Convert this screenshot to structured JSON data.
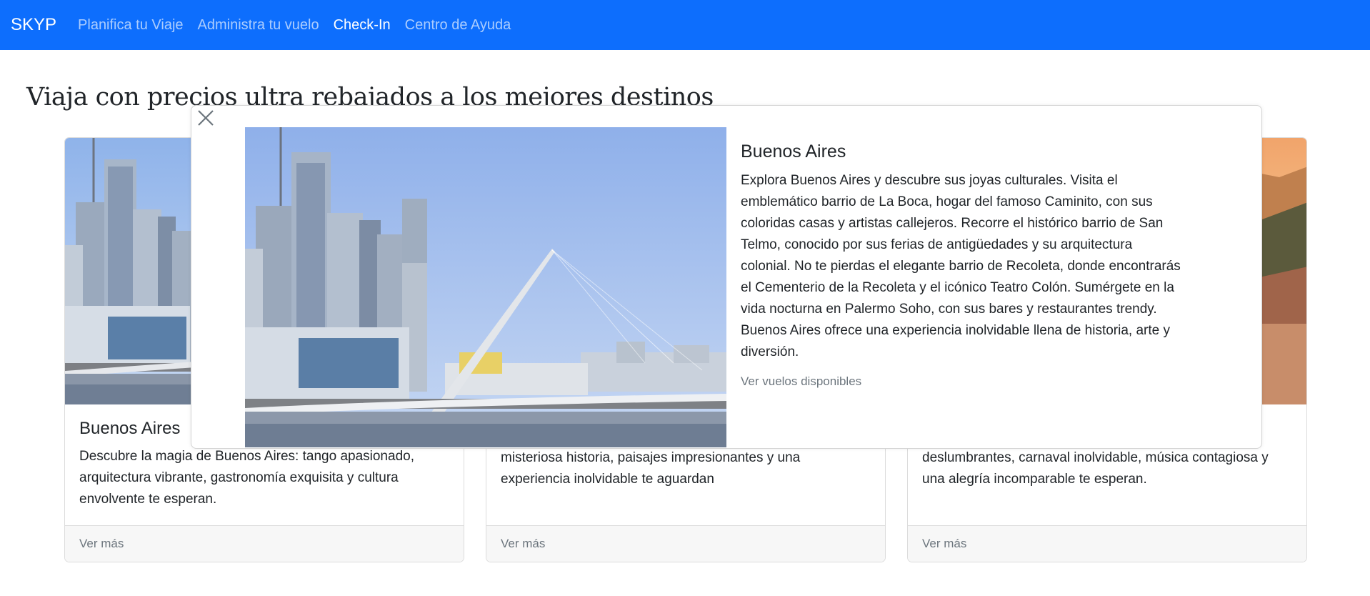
{
  "navbar": {
    "brand": "SKYP",
    "links": [
      {
        "label": "Planifica tu Viaje"
      },
      {
        "label": "Administra tu vuelo"
      },
      {
        "label": "Check-In"
      },
      {
        "label": "Centro de Ayuda"
      }
    ],
    "background": "#0d6efd"
  },
  "main": {
    "heading": "Viaja con precios ultra rebajados a los mejores destinos",
    "cards": [
      {
        "title": "Buenos Aires",
        "text": "Descubre la magia de Buenos Aires: tango apasionado, arquitectura vibrante, gastronomía exquisita y cultura envolvente te esperan.",
        "footer_link": "Ver más"
      },
      {
        "title": "",
        "text": "Embárcate en una aventura única en Machu Picchu: misteriosa historia, paisajes impresionantes y una experiencia inolvidable te aguardan",
        "footer_link": "Ver más"
      },
      {
        "title": "",
        "text": "Vive la energía vibrante de Río de Janeiro: playas deslumbrantes, carnaval inolvidable, música contagiosa y una alegría incomparable te esperan.",
        "footer_link": "Ver más"
      }
    ]
  },
  "modal": {
    "title": "Buenos Aires",
    "text": "Explora Buenos Aires y descubre sus joyas culturales. Visita el emblemático barrio de La Boca, hogar del famoso Caminito, con sus coloridas casas y artistas callejeros. Recorre el histórico barrio de San Telmo, conocido por sus ferias de antigüedades y su arquitectura colonial. No te pierdas el elegante barrio de Recoleta, donde encontrarás el Cementerio de la Recoleta y el icónico Teatro Colón. Sumérgete en la vida nocturna en Palermo Soho, con sus bares y restaurantes trendy. Buenos Aires ofrece una experiencia inolvidable llena de historia, arte y diversión.",
    "link": "Ver vuelos disponibles",
    "close_icon": "close-icon"
  }
}
